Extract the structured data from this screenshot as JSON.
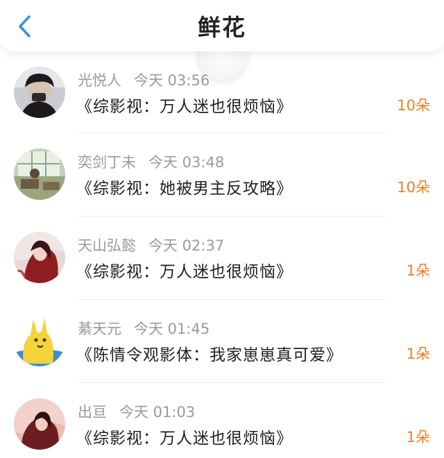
{
  "header": {
    "title": "鲜花",
    "back_icon": "chevron-left-icon",
    "accent": "#3a8ee6"
  },
  "colors": {
    "amount": "#f07d22",
    "meta": "#9a9a9a",
    "text": "#1e1e1e"
  },
  "records": [
    {
      "name": "光悦人",
      "time": "今天 03:56",
      "book": "《综影视：万人迷也很烦恼》",
      "amount": "10朵"
    },
    {
      "name": "奕剑丁未",
      "time": "今天 03:48",
      "book": "《综影视：她被男主反攻略》",
      "amount": "10朵"
    },
    {
      "name": "天山弘懿",
      "time": "今天 02:37",
      "book": "《综影视：万人迷也很烦恼》",
      "amount": "1朵"
    },
    {
      "name": "綦天元",
      "time": "今天 01:45",
      "book": "《陈情令观影体：我家崽崽真可爱》",
      "amount": "1朵"
    },
    {
      "name": "出亘",
      "time": "今天 01:03",
      "book": "《综影视：万人迷也很烦恼》",
      "amount": "1朵"
    }
  ]
}
